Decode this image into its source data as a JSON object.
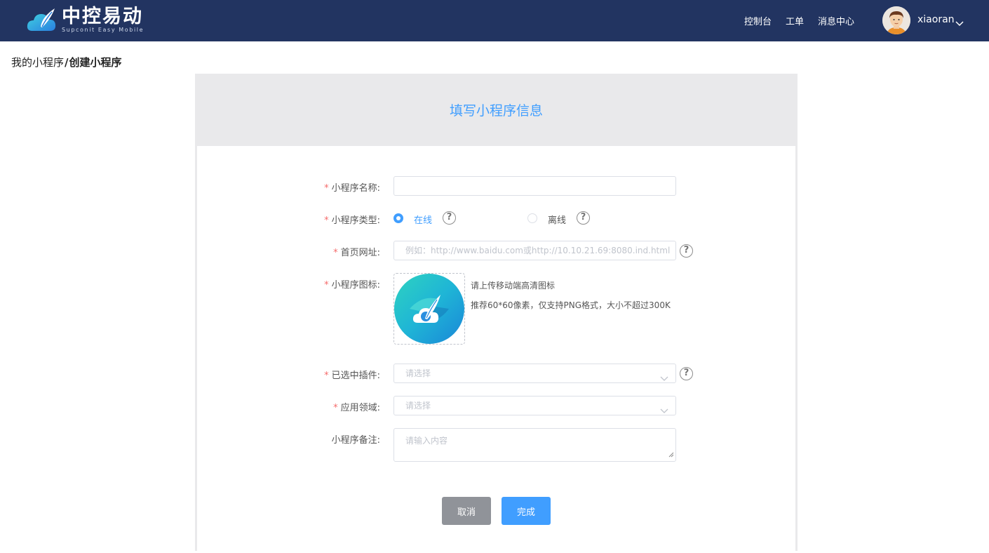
{
  "brand": {
    "title": "中控易动",
    "subtitle": "Supconit Easy Mobile"
  },
  "nav": [
    {
      "label": "控制台"
    },
    {
      "label": "工单"
    },
    {
      "label": "消息中心"
    }
  ],
  "user": {
    "name": "xiaoran"
  },
  "breadcrumb": {
    "parent": "我的小程序",
    "separator": "/",
    "current": "创建小程序"
  },
  "card": {
    "title": "填写小程序信息"
  },
  "form": {
    "name": {
      "label": "小程序名称:",
      "value": ""
    },
    "type": {
      "label": "小程序类型:",
      "options": [
        "在线",
        "离线"
      ],
      "selected": "在线"
    },
    "url": {
      "label": "首页网址:",
      "placeholder": "例如：http://www.baidu.com或http://10.10.21.69:8080.ind.html"
    },
    "icon": {
      "label": "小程序图标:",
      "hint1": "请上传移动端高清图标",
      "hint2": "推荐60*60像素，仅支持PNG格式，大小不超过300K"
    },
    "plugins": {
      "label": "已选中插件:",
      "placeholder": "请选择"
    },
    "domain": {
      "label": "应用领域:",
      "placeholder": "请选择"
    },
    "remark": {
      "label": "小程序备注:",
      "placeholder": "请输入内容"
    },
    "required_mark": "*"
  },
  "buttons": {
    "cancel": "取消",
    "done": "完成"
  },
  "colors": {
    "header_bg": "#223461",
    "primary": "#409eff",
    "required": "#f56c6c",
    "cancel_bg": "#909399"
  }
}
